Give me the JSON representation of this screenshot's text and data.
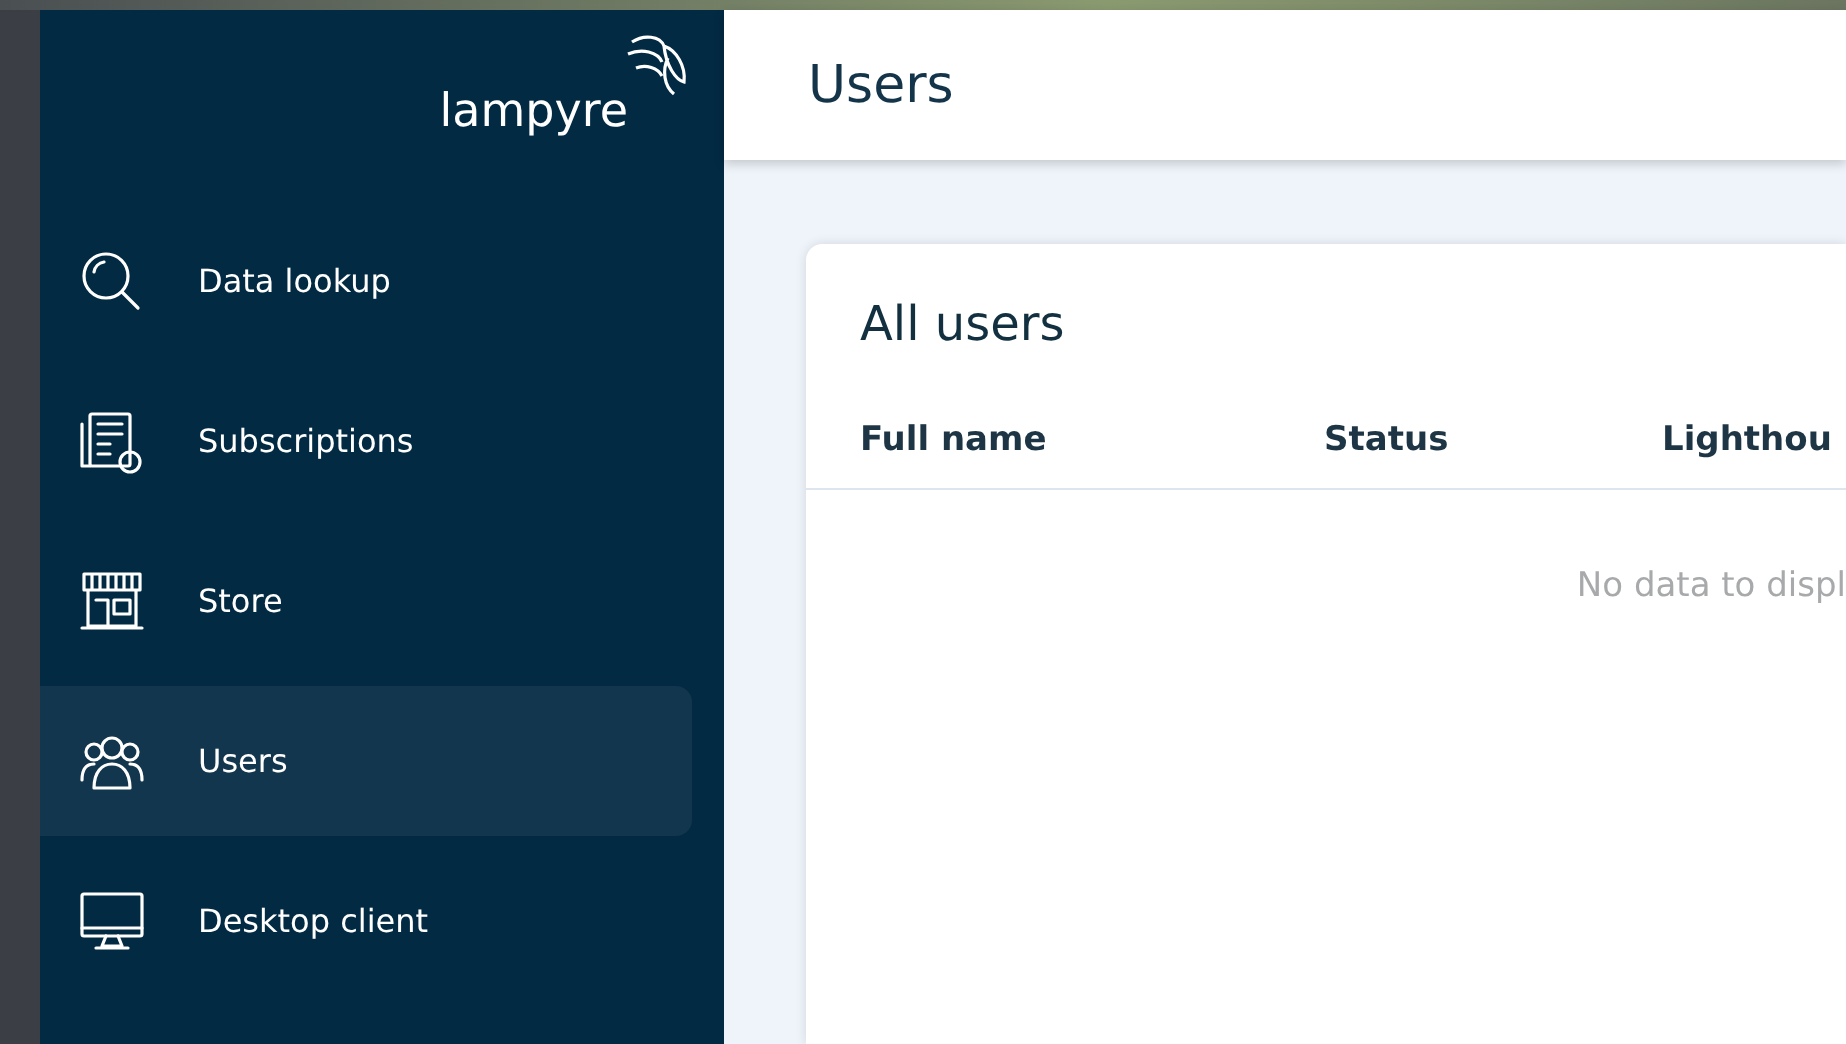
{
  "sidebar": {
    "logo": "lampyre",
    "items": [
      {
        "label": "Data lookup",
        "selected": false
      },
      {
        "label": "Subscriptions",
        "selected": false
      },
      {
        "label": "Store",
        "selected": false
      },
      {
        "label": "Users",
        "selected": true
      },
      {
        "label": "Desktop client",
        "selected": false
      }
    ]
  },
  "header": {
    "title": "Users"
  },
  "card": {
    "title": "All users",
    "columns": [
      "Full name",
      "Status",
      "Lighthou"
    ],
    "empty_message": "No data to displ"
  }
}
